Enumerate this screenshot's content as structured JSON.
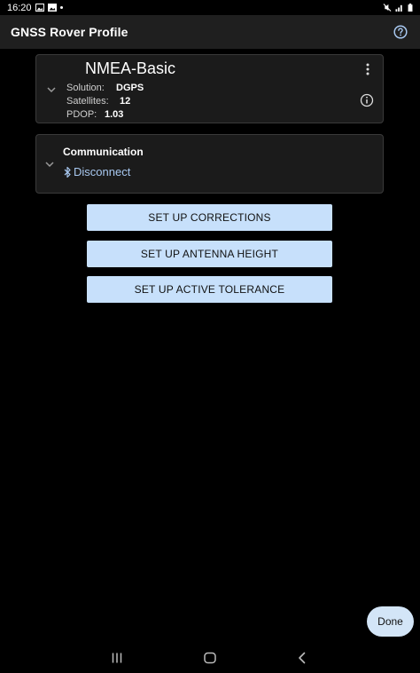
{
  "status_bar": {
    "time": "16:20"
  },
  "app_bar": {
    "title": "GNSS Rover Profile"
  },
  "profile_card": {
    "name": "NMEA-Basic",
    "rows": [
      {
        "label": "Solution:",
        "value": "DGPS"
      },
      {
        "label": "Satellites:",
        "value": "12"
      },
      {
        "label": "PDOP:",
        "value": "1.03"
      }
    ]
  },
  "communication_card": {
    "title": "Communication",
    "action": "Disconnect"
  },
  "actions": {
    "corrections": "SET UP CORRECTIONS",
    "antenna": "SET UP ANTENNA HEIGHT",
    "tolerance": "SET UP ACTIVE TOLERANCE"
  },
  "done_label": "Done",
  "icons": {
    "help": "help-circle-icon",
    "more": "more-vertical-icon",
    "info": "info-icon",
    "expand": "chevron-down-icon",
    "bluetooth": "bluetooth-icon"
  },
  "colors": {
    "button_bg": "#c7e0fb",
    "link": "#a8c8f0",
    "card_bg": "#1b1b1b",
    "app_bar_bg": "#1f1f1f"
  }
}
